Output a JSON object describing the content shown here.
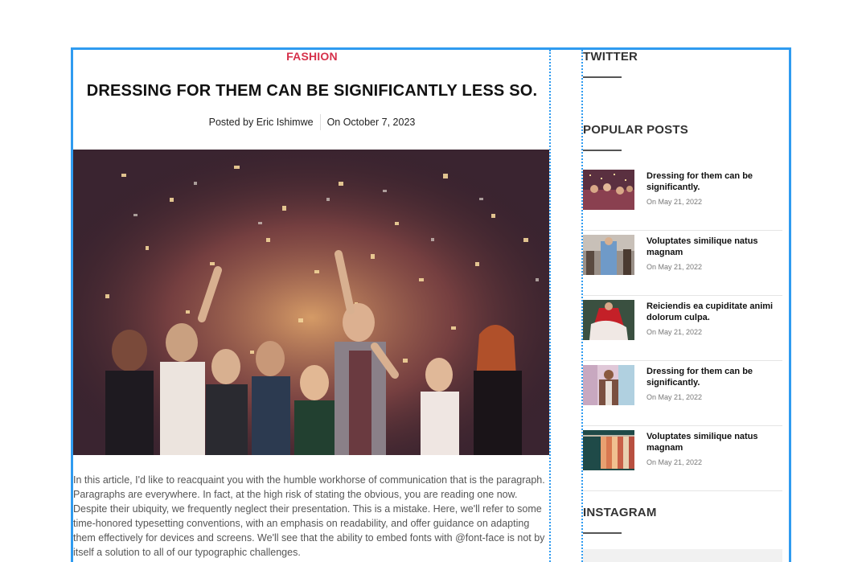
{
  "article": {
    "category": "FASHION",
    "title": "DRESSING FOR THEM CAN BE SIGNIFICANTLY LESS SO.",
    "posted_by": "Posted by Eric Ishimwe",
    "posted_on": "On October 7, 2023",
    "paragraph": "In this article, I'd like to reacquaint you with the humble workhorse of communication that is the paragraph. Paragraphs are everywhere. In fact, at the high risk of stating the obvious, you are reading one now. Despite their ubiquity, we frequently neglect their presentation. This is a mistake. Here, we'll refer to some time-honored typesetting conventions, with an emphasis on readability, and offer guidance on adapting them effectively for devices and screens. We'll see that the ability to embed fonts with @font-face is not by itself a solution to all of our typographic challenges."
  },
  "sidebar": {
    "twitter_heading": "TWITTER",
    "popular_heading": "POPULAR POSTS",
    "instagram_heading": "INSTAGRAM",
    "popular_posts": [
      {
        "title": "Dressing for them can be significantly.",
        "date": "On May 21, 2022"
      },
      {
        "title": "Voluptates similique natus magnam",
        "date": "On May 21, 2022"
      },
      {
        "title": "Reiciendis ea cupiditate animi dolorum culpa.",
        "date": "On May 21, 2022"
      },
      {
        "title": "Dressing for them can be significantly.",
        "date": "On May 21, 2022"
      },
      {
        "title": "Voluptates similique natus magnam",
        "date": "On May 21, 2022"
      }
    ]
  },
  "colors": {
    "accent_category": "#d6304a",
    "frame_border": "#2f9bf0"
  }
}
